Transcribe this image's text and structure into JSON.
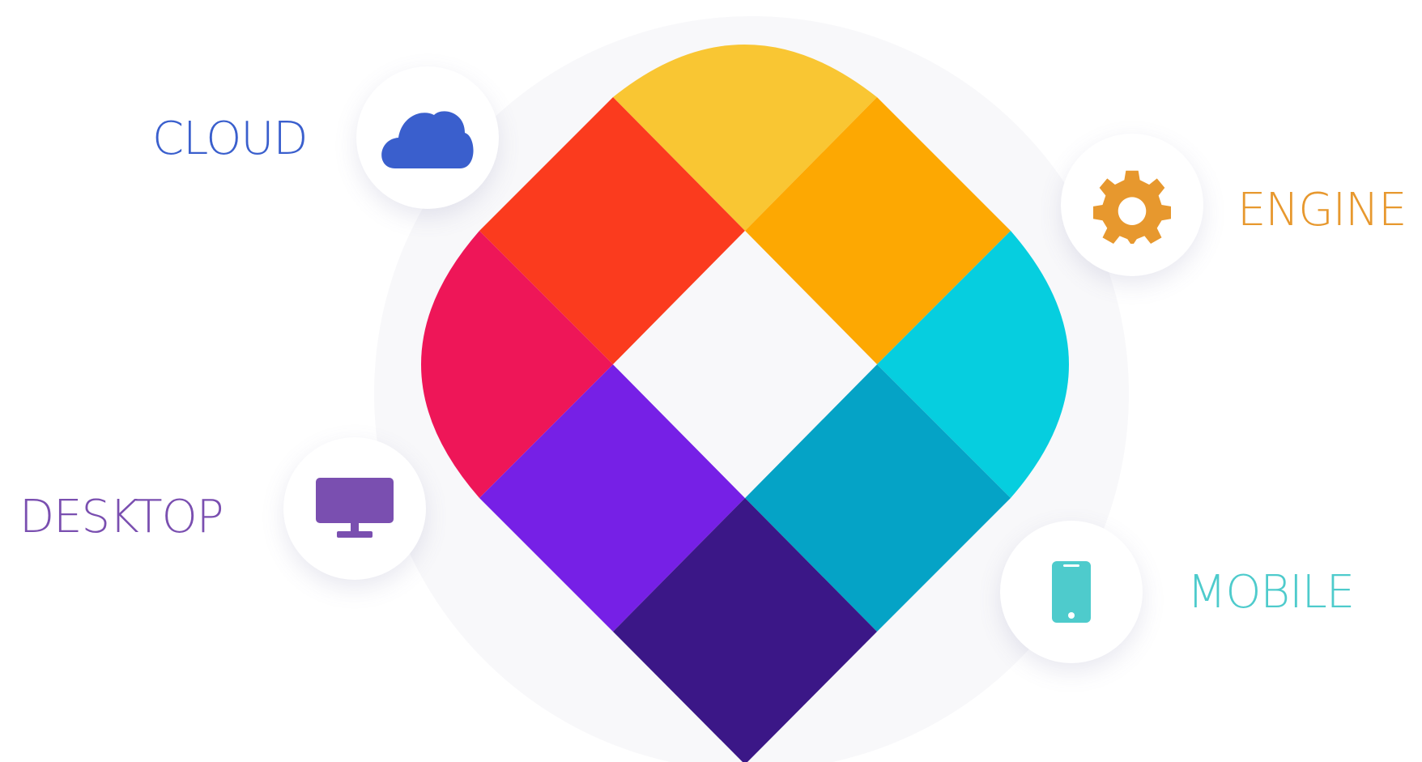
{
  "platforms": {
    "cloud": {
      "label": "CLOUD",
      "icon": "cloud-icon",
      "color": "#3a5fcd"
    },
    "engine": {
      "label": "ENGINE",
      "icon": "gear-icon",
      "color": "#e7982e"
    },
    "desktop": {
      "label": "DESKTOP",
      "icon": "monitor-icon",
      "color": "#7a4fb0"
    },
    "mobile": {
      "label": "MOBILE",
      "icon": "phone-icon",
      "color": "#4ecbcc"
    }
  },
  "logo": {
    "icon": "diamond-logo-icon",
    "colors": {
      "top": "#f9c633",
      "upper_left": "#fb3b1e",
      "upper_right": "#fda802",
      "left": "#ee1658",
      "right": "#06cedf",
      "lower_left": "#7620e6",
      "lower_right": "#05a3c6",
      "bottom": "#3b1787",
      "center": "#f8f8fa"
    }
  }
}
